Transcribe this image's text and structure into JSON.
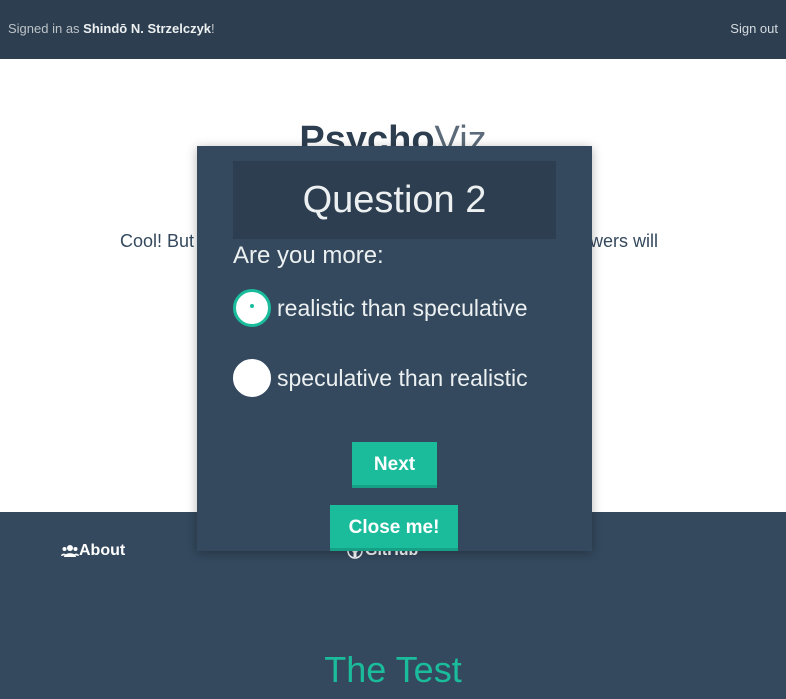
{
  "topbar": {
    "signed_prefix": "Signed in as ",
    "user_name": "Shindō N. Strzelczyk",
    "signed_suffix": "!",
    "signout_label": "Sign out"
  },
  "hero": {
    "logo_bold": "Psycho",
    "logo_light": "Viz",
    "text_left": "Cool! But",
    "text_right": "wers will"
  },
  "nav": {
    "about_label": "About",
    "github_label": "GitHub"
  },
  "section": {
    "title": "The Test"
  },
  "modal": {
    "question_title": "Question 2",
    "prompt": "Are you more:",
    "options": [
      {
        "label": "realistic than speculative",
        "selected": true
      },
      {
        "label": "speculative than realistic",
        "selected": false
      }
    ],
    "next_label": "Next",
    "close_label": "Close me!"
  },
  "colors": {
    "topbar_bg": "#2c3e50",
    "panel_bg": "#34495e",
    "accent": "#1abc9c"
  },
  "icons": {
    "about": "users-icon",
    "github": "github-icon"
  }
}
